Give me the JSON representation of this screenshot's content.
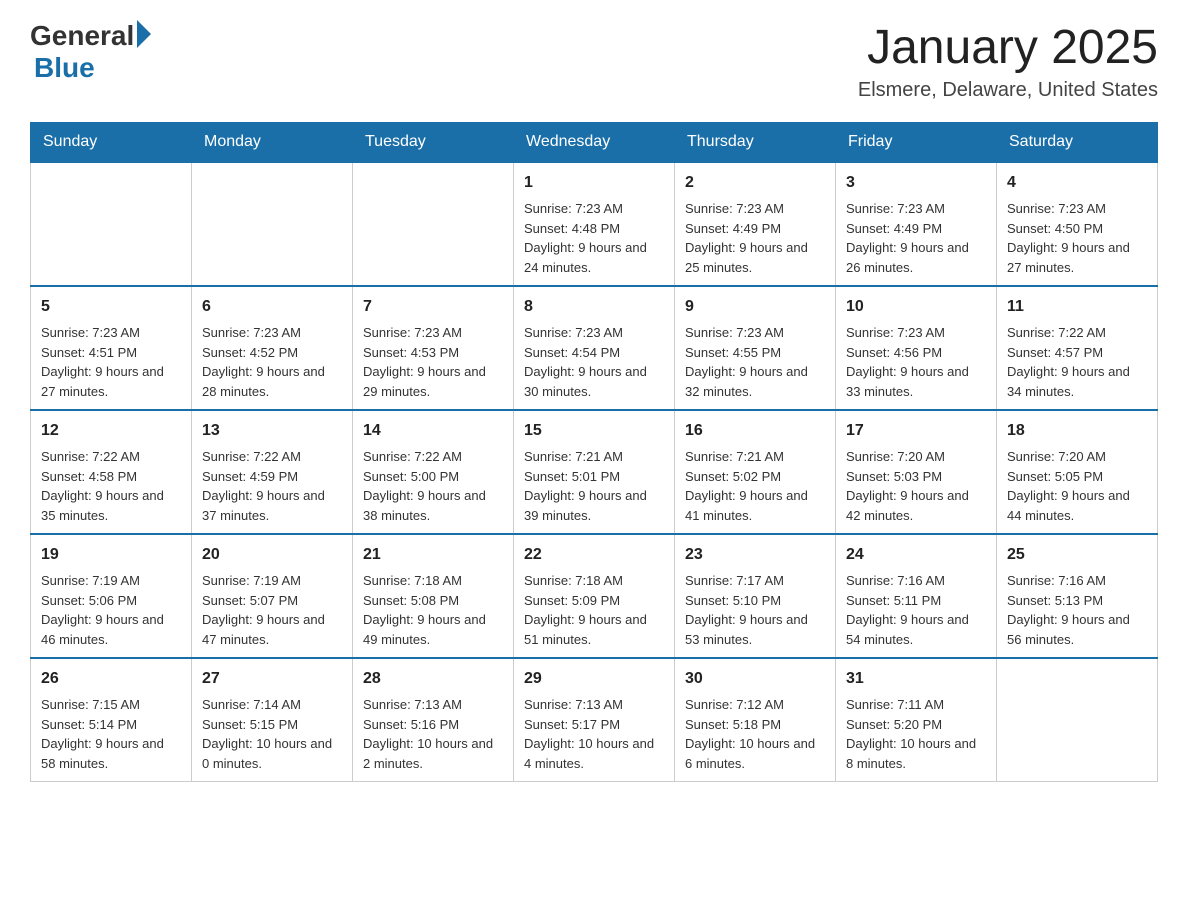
{
  "header": {
    "logo_general": "General",
    "logo_blue": "Blue",
    "month_title": "January 2025",
    "location": "Elsmere, Delaware, United States"
  },
  "weekdays": [
    "Sunday",
    "Monday",
    "Tuesday",
    "Wednesday",
    "Thursday",
    "Friday",
    "Saturday"
  ],
  "weeks": [
    [
      {
        "day": "",
        "sunrise": "",
        "sunset": "",
        "daylight": ""
      },
      {
        "day": "",
        "sunrise": "",
        "sunset": "",
        "daylight": ""
      },
      {
        "day": "",
        "sunrise": "",
        "sunset": "",
        "daylight": ""
      },
      {
        "day": "1",
        "sunrise": "Sunrise: 7:23 AM",
        "sunset": "Sunset: 4:48 PM",
        "daylight": "Daylight: 9 hours and 24 minutes."
      },
      {
        "day": "2",
        "sunrise": "Sunrise: 7:23 AM",
        "sunset": "Sunset: 4:49 PM",
        "daylight": "Daylight: 9 hours and 25 minutes."
      },
      {
        "day": "3",
        "sunrise": "Sunrise: 7:23 AM",
        "sunset": "Sunset: 4:49 PM",
        "daylight": "Daylight: 9 hours and 26 minutes."
      },
      {
        "day": "4",
        "sunrise": "Sunrise: 7:23 AM",
        "sunset": "Sunset: 4:50 PM",
        "daylight": "Daylight: 9 hours and 27 minutes."
      }
    ],
    [
      {
        "day": "5",
        "sunrise": "Sunrise: 7:23 AM",
        "sunset": "Sunset: 4:51 PM",
        "daylight": "Daylight: 9 hours and 27 minutes."
      },
      {
        "day": "6",
        "sunrise": "Sunrise: 7:23 AM",
        "sunset": "Sunset: 4:52 PM",
        "daylight": "Daylight: 9 hours and 28 minutes."
      },
      {
        "day": "7",
        "sunrise": "Sunrise: 7:23 AM",
        "sunset": "Sunset: 4:53 PM",
        "daylight": "Daylight: 9 hours and 29 minutes."
      },
      {
        "day": "8",
        "sunrise": "Sunrise: 7:23 AM",
        "sunset": "Sunset: 4:54 PM",
        "daylight": "Daylight: 9 hours and 30 minutes."
      },
      {
        "day": "9",
        "sunrise": "Sunrise: 7:23 AM",
        "sunset": "Sunset: 4:55 PM",
        "daylight": "Daylight: 9 hours and 32 minutes."
      },
      {
        "day": "10",
        "sunrise": "Sunrise: 7:23 AM",
        "sunset": "Sunset: 4:56 PM",
        "daylight": "Daylight: 9 hours and 33 minutes."
      },
      {
        "day": "11",
        "sunrise": "Sunrise: 7:22 AM",
        "sunset": "Sunset: 4:57 PM",
        "daylight": "Daylight: 9 hours and 34 minutes."
      }
    ],
    [
      {
        "day": "12",
        "sunrise": "Sunrise: 7:22 AM",
        "sunset": "Sunset: 4:58 PM",
        "daylight": "Daylight: 9 hours and 35 minutes."
      },
      {
        "day": "13",
        "sunrise": "Sunrise: 7:22 AM",
        "sunset": "Sunset: 4:59 PM",
        "daylight": "Daylight: 9 hours and 37 minutes."
      },
      {
        "day": "14",
        "sunrise": "Sunrise: 7:22 AM",
        "sunset": "Sunset: 5:00 PM",
        "daylight": "Daylight: 9 hours and 38 minutes."
      },
      {
        "day": "15",
        "sunrise": "Sunrise: 7:21 AM",
        "sunset": "Sunset: 5:01 PM",
        "daylight": "Daylight: 9 hours and 39 minutes."
      },
      {
        "day": "16",
        "sunrise": "Sunrise: 7:21 AM",
        "sunset": "Sunset: 5:02 PM",
        "daylight": "Daylight: 9 hours and 41 minutes."
      },
      {
        "day": "17",
        "sunrise": "Sunrise: 7:20 AM",
        "sunset": "Sunset: 5:03 PM",
        "daylight": "Daylight: 9 hours and 42 minutes."
      },
      {
        "day": "18",
        "sunrise": "Sunrise: 7:20 AM",
        "sunset": "Sunset: 5:05 PM",
        "daylight": "Daylight: 9 hours and 44 minutes."
      }
    ],
    [
      {
        "day": "19",
        "sunrise": "Sunrise: 7:19 AM",
        "sunset": "Sunset: 5:06 PM",
        "daylight": "Daylight: 9 hours and 46 minutes."
      },
      {
        "day": "20",
        "sunrise": "Sunrise: 7:19 AM",
        "sunset": "Sunset: 5:07 PM",
        "daylight": "Daylight: 9 hours and 47 minutes."
      },
      {
        "day": "21",
        "sunrise": "Sunrise: 7:18 AM",
        "sunset": "Sunset: 5:08 PM",
        "daylight": "Daylight: 9 hours and 49 minutes."
      },
      {
        "day": "22",
        "sunrise": "Sunrise: 7:18 AM",
        "sunset": "Sunset: 5:09 PM",
        "daylight": "Daylight: 9 hours and 51 minutes."
      },
      {
        "day": "23",
        "sunrise": "Sunrise: 7:17 AM",
        "sunset": "Sunset: 5:10 PM",
        "daylight": "Daylight: 9 hours and 53 minutes."
      },
      {
        "day": "24",
        "sunrise": "Sunrise: 7:16 AM",
        "sunset": "Sunset: 5:11 PM",
        "daylight": "Daylight: 9 hours and 54 minutes."
      },
      {
        "day": "25",
        "sunrise": "Sunrise: 7:16 AM",
        "sunset": "Sunset: 5:13 PM",
        "daylight": "Daylight: 9 hours and 56 minutes."
      }
    ],
    [
      {
        "day": "26",
        "sunrise": "Sunrise: 7:15 AM",
        "sunset": "Sunset: 5:14 PM",
        "daylight": "Daylight: 9 hours and 58 minutes."
      },
      {
        "day": "27",
        "sunrise": "Sunrise: 7:14 AM",
        "sunset": "Sunset: 5:15 PM",
        "daylight": "Daylight: 10 hours and 0 minutes."
      },
      {
        "day": "28",
        "sunrise": "Sunrise: 7:13 AM",
        "sunset": "Sunset: 5:16 PM",
        "daylight": "Daylight: 10 hours and 2 minutes."
      },
      {
        "day": "29",
        "sunrise": "Sunrise: 7:13 AM",
        "sunset": "Sunset: 5:17 PM",
        "daylight": "Daylight: 10 hours and 4 minutes."
      },
      {
        "day": "30",
        "sunrise": "Sunrise: 7:12 AM",
        "sunset": "Sunset: 5:18 PM",
        "daylight": "Daylight: 10 hours and 6 minutes."
      },
      {
        "day": "31",
        "sunrise": "Sunrise: 7:11 AM",
        "sunset": "Sunset: 5:20 PM",
        "daylight": "Daylight: 10 hours and 8 minutes."
      },
      {
        "day": "",
        "sunrise": "",
        "sunset": "",
        "daylight": ""
      }
    ]
  ]
}
